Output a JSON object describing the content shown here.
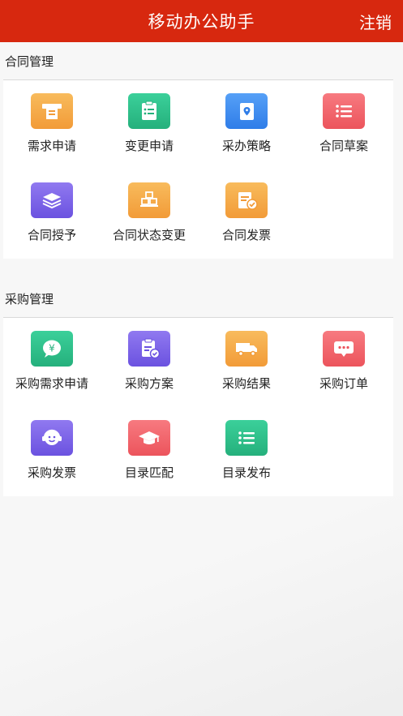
{
  "header": {
    "title": "移动办公助手",
    "logout_label": "注销"
  },
  "contract": {
    "title": "合同管理",
    "items": [
      {
        "label": "需求申请",
        "icon": "receipt-icon",
        "color": "#f5a442"
      },
      {
        "label": "变更申请",
        "icon": "clipboard-list-icon",
        "color": "#2fbf8a"
      },
      {
        "label": "采办策略",
        "icon": "location-book-icon",
        "color": "#3f8ef0"
      },
      {
        "label": "合同草案",
        "icon": "list-icon",
        "color": "#f0626a"
      },
      {
        "label": "合同授予",
        "icon": "layers-icon",
        "color": "#7b63e8"
      },
      {
        "label": "合同状态变更",
        "icon": "boxes-icon",
        "color": "#f5a442"
      },
      {
        "label": "合同发票",
        "icon": "invoice-check-icon",
        "color": "#f5a442"
      }
    ]
  },
  "purchase": {
    "title": "采购管理",
    "items": [
      {
        "label": "采购需求申请",
        "icon": "yen-chat-icon",
        "color": "#2fbf8a"
      },
      {
        "label": "采购方案",
        "icon": "clipboard-check-icon",
        "color": "#7b63e8"
      },
      {
        "label": "采购结果",
        "icon": "truck-icon",
        "color": "#f5a442"
      },
      {
        "label": "采购订单",
        "icon": "message-icon",
        "color": "#f0626a"
      },
      {
        "label": "采购发票",
        "icon": "headset-face-icon",
        "color": "#7b63e8"
      },
      {
        "label": "目录匹配",
        "icon": "graduation-cap-icon",
        "color": "#f0626a"
      },
      {
        "label": "目录发布",
        "icon": "list-icon",
        "color": "#2fbf8a"
      }
    ]
  }
}
